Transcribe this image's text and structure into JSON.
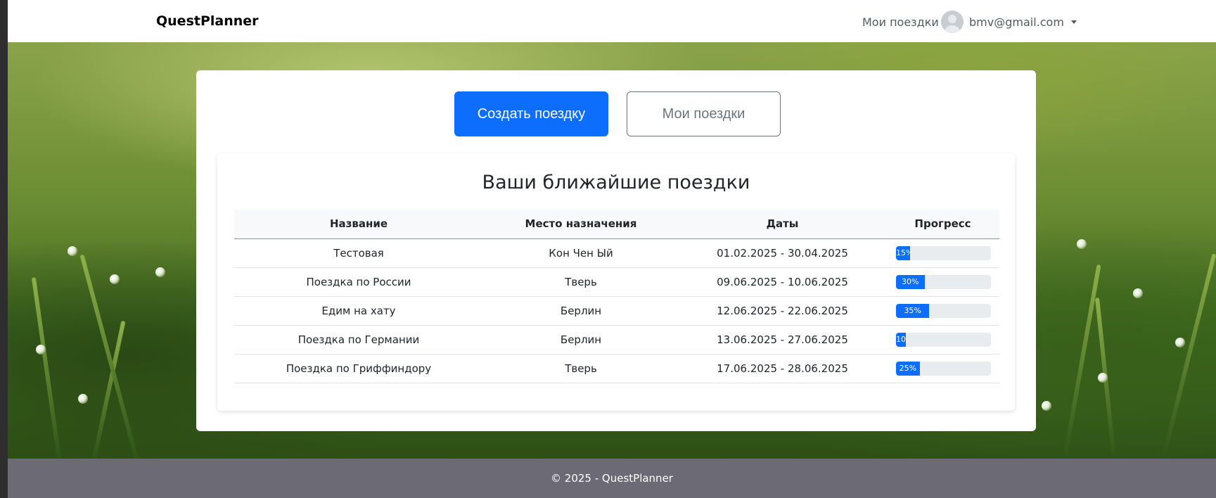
{
  "navbar": {
    "brand": "QuestPlanner",
    "nav_link": "Мои поездки",
    "user_email": "bmv@gmail.com",
    "avatar_icon": "user-avatar-icon",
    "caret_icon": "caret-down-icon"
  },
  "actions": {
    "create_label": "Создать поездку",
    "my_trips_label": "Мои поездки",
    "primary_color": "#0d6efd"
  },
  "trips": {
    "title": "Ваши ближайшие поездки",
    "columns": [
      "Название",
      "Место назначения",
      "Даты",
      "Прогресс"
    ],
    "rows": [
      {
        "name": "Тестовая",
        "destination": "Кон Чен Ый",
        "dates": "01.02.2025 - 30.04.2025",
        "progress": 15,
        "progress_label": "15%"
      },
      {
        "name": "Поездка по России",
        "destination": "Тверь",
        "dates": "09.06.2025 - 10.06.2025",
        "progress": 30,
        "progress_label": "30%"
      },
      {
        "name": "Едим на хату",
        "destination": "Берлин",
        "dates": "12.06.2025 - 22.06.2025",
        "progress": 35,
        "progress_label": "35%"
      },
      {
        "name": "Поездка по Германии",
        "destination": "Берлин",
        "dates": "13.06.2025 - 27.06.2025",
        "progress": 10,
        "progress_label": "10%"
      },
      {
        "name": "Поездка по Гриффиндору",
        "destination": "Тверь",
        "dates": "17.06.2025 - 28.06.2025",
        "progress": 25,
        "progress_label": "25%"
      }
    ]
  },
  "footer": {
    "text": "© 2025 - QuestPlanner"
  }
}
